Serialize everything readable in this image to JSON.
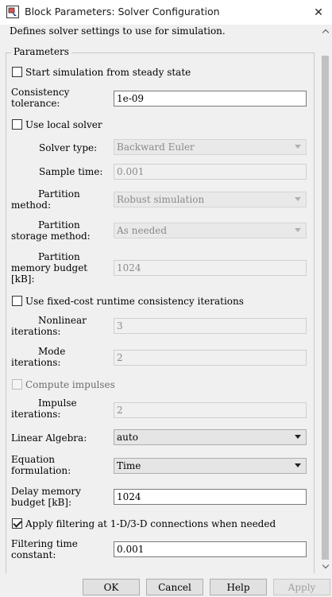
{
  "window": {
    "title": "Block Parameters: Solver Configuration",
    "close_glyph": "✕"
  },
  "description": "Defines solver settings to use for simulation.",
  "parameters": {
    "legend": "Parameters",
    "start_steady_state": {
      "label": "Start simulation from steady state",
      "checked": false
    },
    "consistency_tolerance": {
      "label_line1": "Consistency",
      "label_line2": "tolerance:",
      "value": "1e-09"
    },
    "use_local_solver": {
      "label": "Use local solver",
      "checked": false
    },
    "solver_type": {
      "label": "Solver type:",
      "value": "Backward Euler"
    },
    "sample_time": {
      "label": "Sample time:",
      "value": "0.001"
    },
    "partition_method": {
      "label_line1": "Partition",
      "label_line2": "method:",
      "value": "Robust simulation"
    },
    "partition_storage_method": {
      "label_line1": "Partition",
      "label_line2": "storage method:",
      "value": "As needed"
    },
    "partition_memory_budget": {
      "label_line1": "Partition",
      "label_line2": "memory budget",
      "label_line3": "[kB]:",
      "value": "1024"
    },
    "fixed_cost_iterations": {
      "label": "Use fixed-cost runtime consistency iterations",
      "checked": false
    },
    "nonlinear_iterations": {
      "label_line1": "Nonlinear",
      "label_line2": "iterations:",
      "value": "3"
    },
    "mode_iterations": {
      "label_line1": "Mode",
      "label_line2": "iterations:",
      "value": "2"
    },
    "compute_impulses": {
      "label": "Compute impulses",
      "checked": false
    },
    "impulse_iterations": {
      "label_line1": "Impulse",
      "label_line2": "iterations:",
      "value": "2"
    },
    "linear_algebra": {
      "label": "Linear Algebra:",
      "value": "auto"
    },
    "equation_formulation": {
      "label_line1": "Equation",
      "label_line2": "formulation:",
      "value": "Time"
    },
    "delay_memory_budget": {
      "label_line1": "Delay memory",
      "label_line2": "budget [kB]:",
      "value": "1024"
    },
    "apply_filtering": {
      "label": "Apply filtering at 1-D/3-D connections when needed",
      "checked": true
    },
    "filtering_time_constant": {
      "label_line1": "Filtering time",
      "label_line2": "constant:",
      "value": "0.001"
    }
  },
  "buttons": {
    "ok": "OK",
    "cancel": "Cancel",
    "help": "Help",
    "apply": "Apply"
  }
}
